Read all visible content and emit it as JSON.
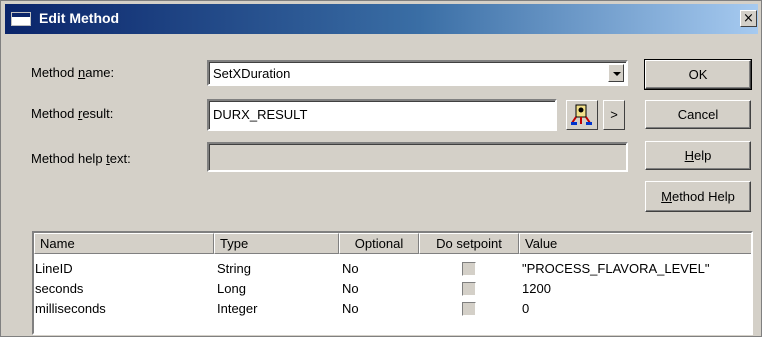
{
  "window": {
    "title": "Edit Method",
    "close_glyph": "×"
  },
  "form": {
    "method_name": {
      "label_pre": "Method ",
      "label_accel": "n",
      "label_post": "ame:",
      "value": "SetXDuration"
    },
    "method_result": {
      "label_pre": "Method ",
      "label_accel": "r",
      "label_post": "esult:",
      "value": "DURX_RESULT",
      "arrow_label": ">"
    },
    "help_text": {
      "label_pre": "Method help ",
      "label_accel": "t",
      "label_post": "ext:",
      "value": ""
    }
  },
  "buttons": {
    "ok": "OK",
    "cancel": "Cancel",
    "help_accel": "H",
    "help_rest": "elp",
    "method_help_accel": "M",
    "method_help_rest": "ethod Help"
  },
  "table": {
    "columns": [
      "Name",
      "Type",
      "Optional",
      "Do setpoint",
      "Value"
    ],
    "rows": [
      {
        "name": "LineID",
        "type": "String",
        "optional": "No",
        "setpoint": false,
        "value": "\"PROCESS_FLAVORA_LEVEL\""
      },
      {
        "name": "seconds",
        "type": "Long",
        "optional": "No",
        "setpoint": false,
        "value": "1200"
      },
      {
        "name": "milliseconds",
        "type": "Integer",
        "optional": "No",
        "setpoint": false,
        "value": "0"
      }
    ]
  },
  "icons": {
    "title": "dialog-window-icon",
    "picker": "variable-picker-icon"
  },
  "colors": {
    "titlebar_start": "#0a246a",
    "titlebar_end": "#a6caf0",
    "dialog_bg": "#d4d0c8"
  }
}
